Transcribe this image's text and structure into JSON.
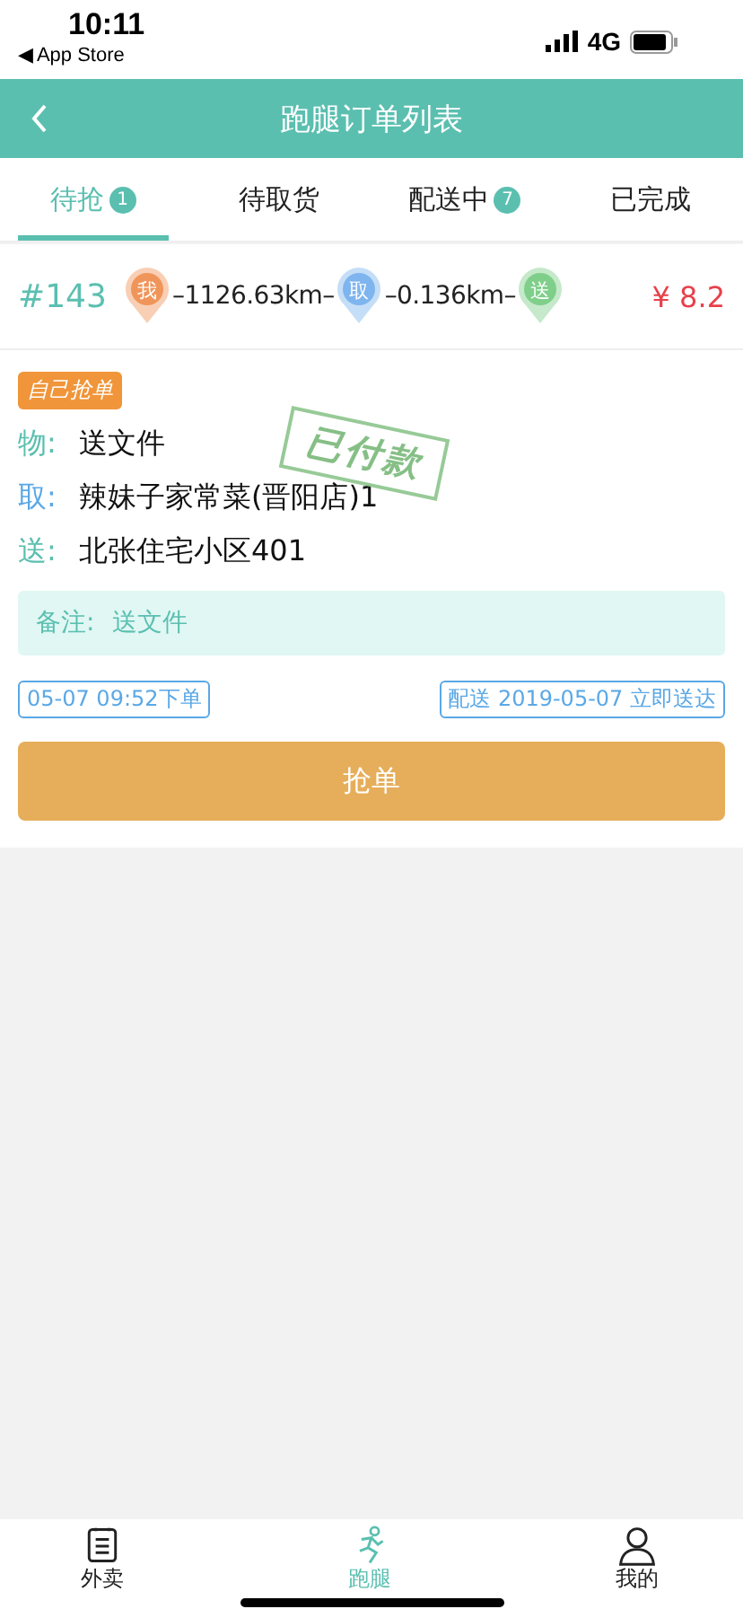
{
  "status_bar": {
    "time": "10:11",
    "back_app": "◀ App Store",
    "network": "4G"
  },
  "header": {
    "title": "跑腿订单列表"
  },
  "tabs": [
    {
      "label": "待抢",
      "badge": "1",
      "selected": true
    },
    {
      "label": "待取货",
      "selected": false
    },
    {
      "label": "配送中",
      "badge": "7",
      "selected": false
    },
    {
      "label": "已完成",
      "selected": false
    }
  ],
  "order": {
    "number": "#143",
    "route": [
      {
        "kind": "pin",
        "label": "我",
        "color": "#f0955a"
      },
      {
        "kind": "distance",
        "label": "–1126.63km–"
      },
      {
        "kind": "pin",
        "label": "取",
        "color": "#7fb5ee"
      },
      {
        "kind": "distance",
        "label": "–0.136km–"
      },
      {
        "kind": "pin",
        "label": "送",
        "color": "#7fcf8a"
      }
    ],
    "price": "¥ 8.2",
    "tag": "自己抢单",
    "stamp": "已付款",
    "fields": [
      {
        "label": "物:",
        "value": "送文件",
        "color": "#5bbfb0"
      },
      {
        "label": "取:",
        "value": "辣妹子家常菜(晋阳店)1",
        "color": "#5aa8e6"
      },
      {
        "label": "送:",
        "value": "北张住宅小区401",
        "color": "#5bbfb0"
      }
    ],
    "note": {
      "label": "备注:",
      "value": "送文件"
    },
    "order_time": "05-07 09:52下单",
    "delivery_time": "配送 2019-05-07 立即送达",
    "action": "抢单"
  },
  "bottom_nav": [
    {
      "label": "外卖",
      "kind": "list",
      "selected": false
    },
    {
      "label": "跑腿",
      "kind": "runner",
      "selected": true
    },
    {
      "label": "我的",
      "kind": "person",
      "selected": false
    }
  ]
}
